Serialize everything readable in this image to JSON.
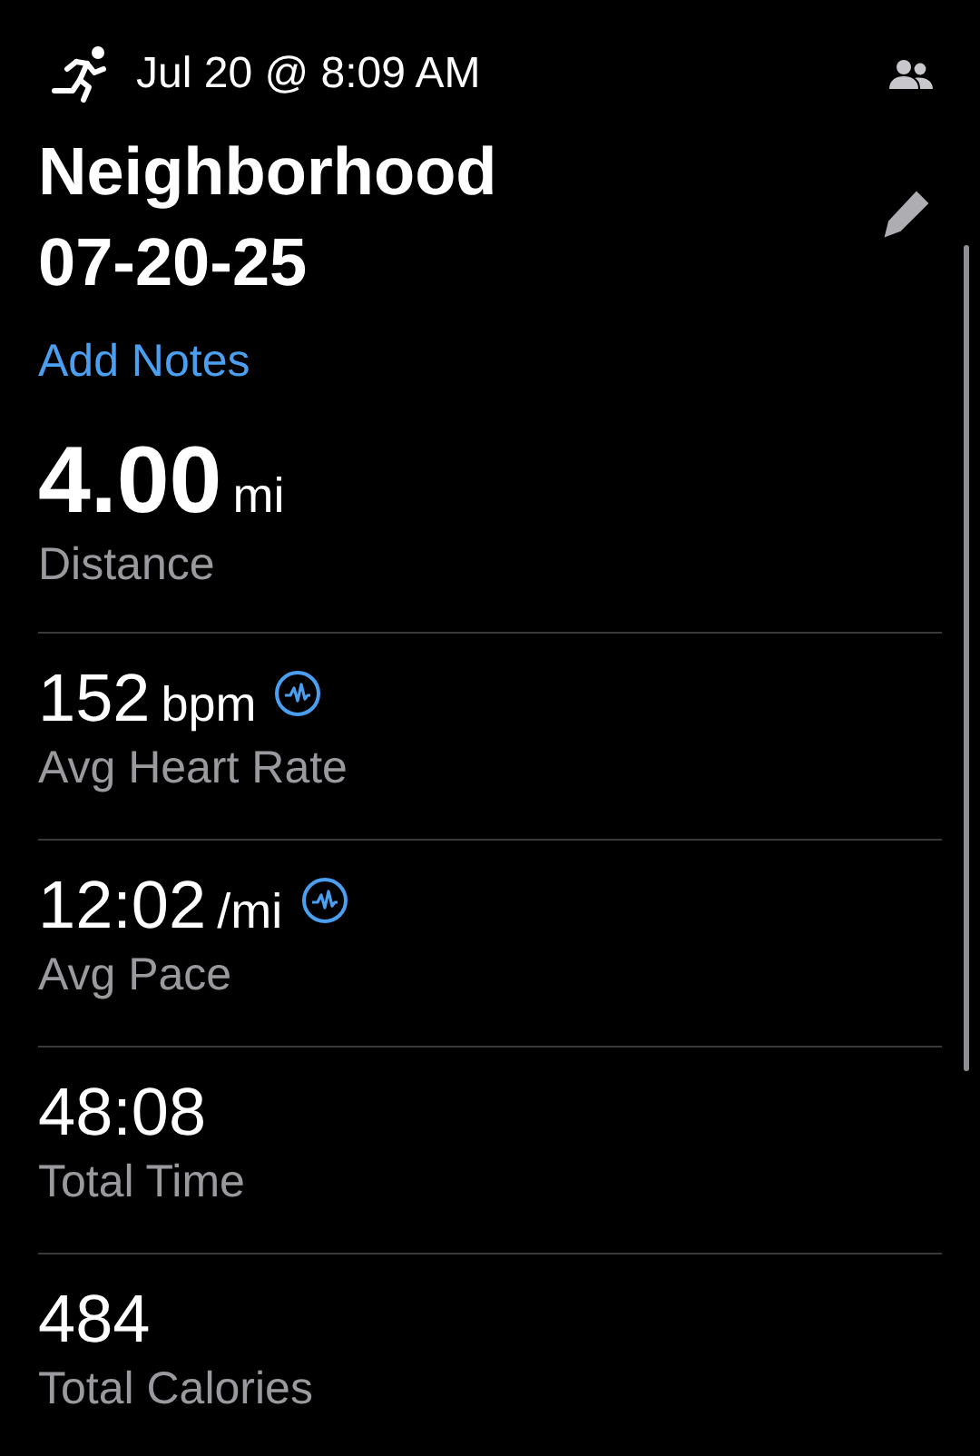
{
  "header": {
    "datetime": "Jul 20 @ 8:09 AM"
  },
  "title": "Neighborhood\n07-20-25",
  "add_notes_link": "Add Notes",
  "metrics": [
    {
      "kind": "primary",
      "value": "4.00",
      "unit": "mi",
      "label": "Distance",
      "has_chart": false
    },
    {
      "kind": "standard",
      "value": "152",
      "unit": "bpm",
      "label": "Avg Heart Rate",
      "has_chart": true
    },
    {
      "kind": "standard",
      "value": "12:02",
      "unit": "/mi",
      "label": "Avg Pace",
      "has_chart": true
    },
    {
      "kind": "standard",
      "value": "48:08",
      "label": "Total Time",
      "has_chart": false
    },
    {
      "kind": "standard",
      "value": "484",
      "label": "Total Calories",
      "has_chart": false
    }
  ]
}
